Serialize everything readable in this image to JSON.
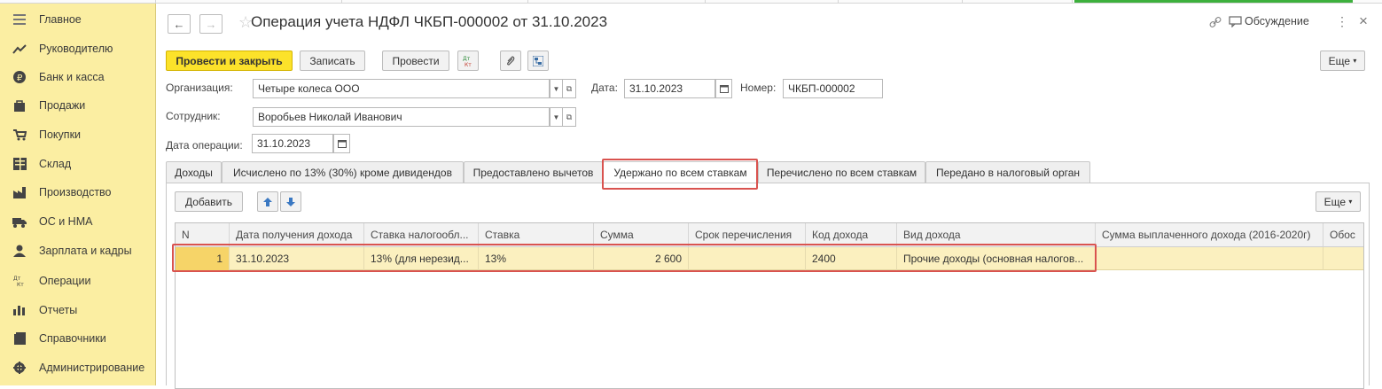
{
  "sidebar": {
    "items": [
      {
        "label": "Главное",
        "icon": "menu-icon"
      },
      {
        "label": "Руководителю",
        "icon": "trend-icon"
      },
      {
        "label": "Банк и касса",
        "icon": "ruble-icon"
      },
      {
        "label": "Продажи",
        "icon": "bag-icon"
      },
      {
        "label": "Покупки",
        "icon": "cart-icon"
      },
      {
        "label": "Склад",
        "icon": "warehouse-icon"
      },
      {
        "label": "Производство",
        "icon": "factory-icon"
      },
      {
        "label": "ОС и НМА",
        "icon": "truck-icon"
      },
      {
        "label": "Зарплата и кадры",
        "icon": "person-icon"
      },
      {
        "label": "Операции",
        "icon": "dt-kt-icon"
      },
      {
        "label": "Отчеты",
        "icon": "bar-chart-icon"
      },
      {
        "label": "Справочники",
        "icon": "book-icon"
      },
      {
        "label": "Администрирование",
        "icon": "gear-icon"
      }
    ]
  },
  "header": {
    "title": "Операция учета НДФЛ ЧКБП-000002 от 31.10.2023",
    "discuss_label": "Обсуждение",
    "more_glyph": "⋮",
    "close_glyph": "×"
  },
  "toolbar": {
    "post_close_label": "Провести и закрыть",
    "save_label": "Записать",
    "post_label": "Провести",
    "dtkt_label": "Дт Кт",
    "more_label": "Еще"
  },
  "form": {
    "org_label": "Организация:",
    "org_value": "Четыре колеса ООО",
    "date_label": "Дата:",
    "date_value": "31.10.2023",
    "number_label": "Номер:",
    "number_value": "ЧКБП-000002",
    "employee_label": "Сотрудник:",
    "employee_value": "Воробьев Николай Иванович",
    "op_date_label": "Дата операции:",
    "op_date_value": "31.10.2023"
  },
  "tabs": [
    {
      "label": "Доходы"
    },
    {
      "label": "Исчислено по 13% (30%) кроме дивидендов"
    },
    {
      "label": "Предоставлено вычетов"
    },
    {
      "label": "Удержано по всем ставкам"
    },
    {
      "label": "Перечислено по всем ставкам"
    },
    {
      "label": "Передано в налоговый орган"
    }
  ],
  "table_toolbar": {
    "add_label": "Добавить",
    "more_label": "Еще"
  },
  "table": {
    "columns": [
      "N",
      "Дата получения дохода",
      "Ставка налогообл...",
      "Ставка",
      "Сумма",
      "Срок перечисления",
      "Код дохода",
      "Вид дохода",
      "Сумма выплаченного дохода (2016-2020г)",
      "Обос"
    ],
    "rows": [
      [
        "1",
        "31.10.2023",
        "13% (для нерезид...",
        "13%",
        "2 600",
        "",
        "2400",
        "Прочие доходы (основная налогов...",
        "",
        ""
      ]
    ]
  },
  "colors": {
    "sidebar_bg": "#fbeea2",
    "primary_button": "#fce22a",
    "selected_row": "#fbf0bf",
    "highlight_border": "#d9534f"
  }
}
